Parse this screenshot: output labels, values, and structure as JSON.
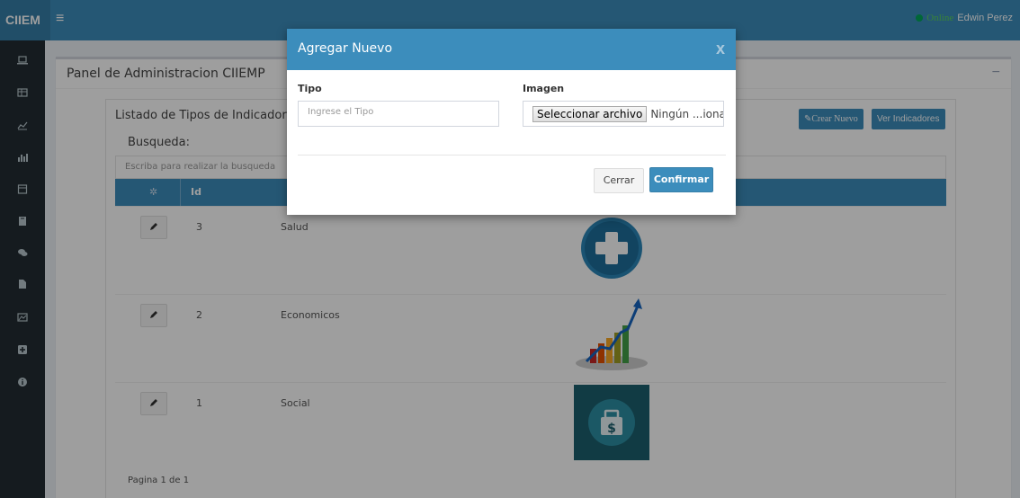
{
  "topbar": {
    "brand": "CIIEM",
    "menu_icon": "hamburger-icon",
    "online_label": "Online",
    "user_name": "Edwin Perez"
  },
  "sidebar": {
    "icons": [
      "laptop-icon",
      "table-icon",
      "line-chart-icon",
      "bar-chart-icon",
      "calendar-icon",
      "book-icon",
      "comments-icon",
      "file-icon",
      "image-icon",
      "plus-square-icon",
      "info-icon"
    ]
  },
  "panel": {
    "title": "Panel de Administracion CIIEMP",
    "collapse": "−"
  },
  "listing": {
    "title": "Listado de Tipos de Indicadores",
    "create_button": "Crear Nuevo",
    "view_button": "Ver Indicadores",
    "search_label": "Busqueda:",
    "search_placeholder": "Escriba para realizar la busqueda",
    "header_id": "Id",
    "rows": [
      {
        "id": "3",
        "name": "Salud",
        "image": "health-cross-icon"
      },
      {
        "id": "2",
        "name": "Economicos",
        "image": "growth-chart-icon"
      },
      {
        "id": "1",
        "name": "Social",
        "image": "money-bag-icon"
      }
    ],
    "pager": "Pagina 1 de 1"
  },
  "modal": {
    "title": "Agregar Nuevo",
    "close": "x",
    "tipo_label": "Tipo",
    "tipo_placeholder": "Ingrese el Tipo",
    "imagen_label": "Imagen",
    "file_button": "Seleccionar archivo",
    "file_name": "Ningún ...ionado",
    "cancel_button": "Cerrar",
    "confirm_button": "Confirmar"
  },
  "colors": {
    "primary": "#3c8dbc",
    "sidebar": "#222d32",
    "online": "#00a65a"
  }
}
